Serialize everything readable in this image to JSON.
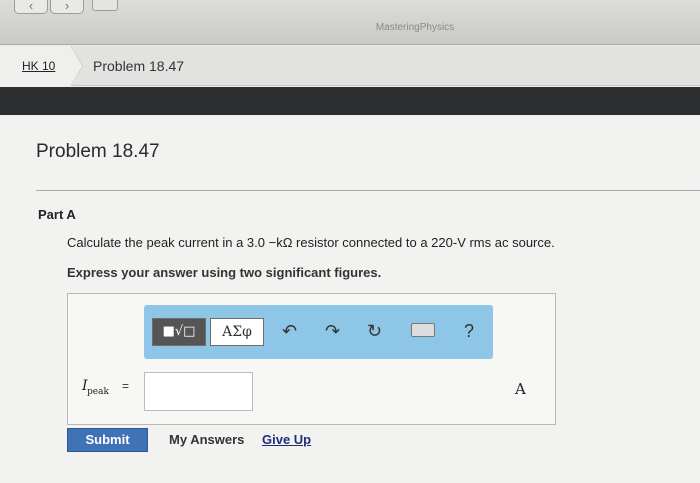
{
  "window": {
    "title": "MasteringPhysics",
    "back_icon": "‹",
    "forward_icon": "›"
  },
  "breadcrumb": {
    "assignment": "HK 10",
    "problem": "Problem 18.47"
  },
  "main": {
    "title": "Problem 18.47",
    "part_label": "Part A",
    "question": "Calculate the peak current in a 3.0 −kΩ resistor connected to a 220-V rms ac source.",
    "instruction": "Express your answer using two significant figures."
  },
  "editor": {
    "templates_label": "■√□",
    "symbols_label": "ΑΣφ",
    "undo_icon": "↶",
    "redo_icon": "↷",
    "reset_icon": "↻",
    "help_label": "?",
    "variable": "I",
    "variable_subscript": "peak",
    "equals": "=",
    "answer_value": "",
    "unit": "A"
  },
  "actions": {
    "submit": "Submit",
    "my_answers": "My Answers",
    "give_up": "Give Up"
  },
  "colors": {
    "toolbar": "#8ec6e8",
    "submit": "#3f73b5",
    "dark_band": "#2d2e2f"
  }
}
